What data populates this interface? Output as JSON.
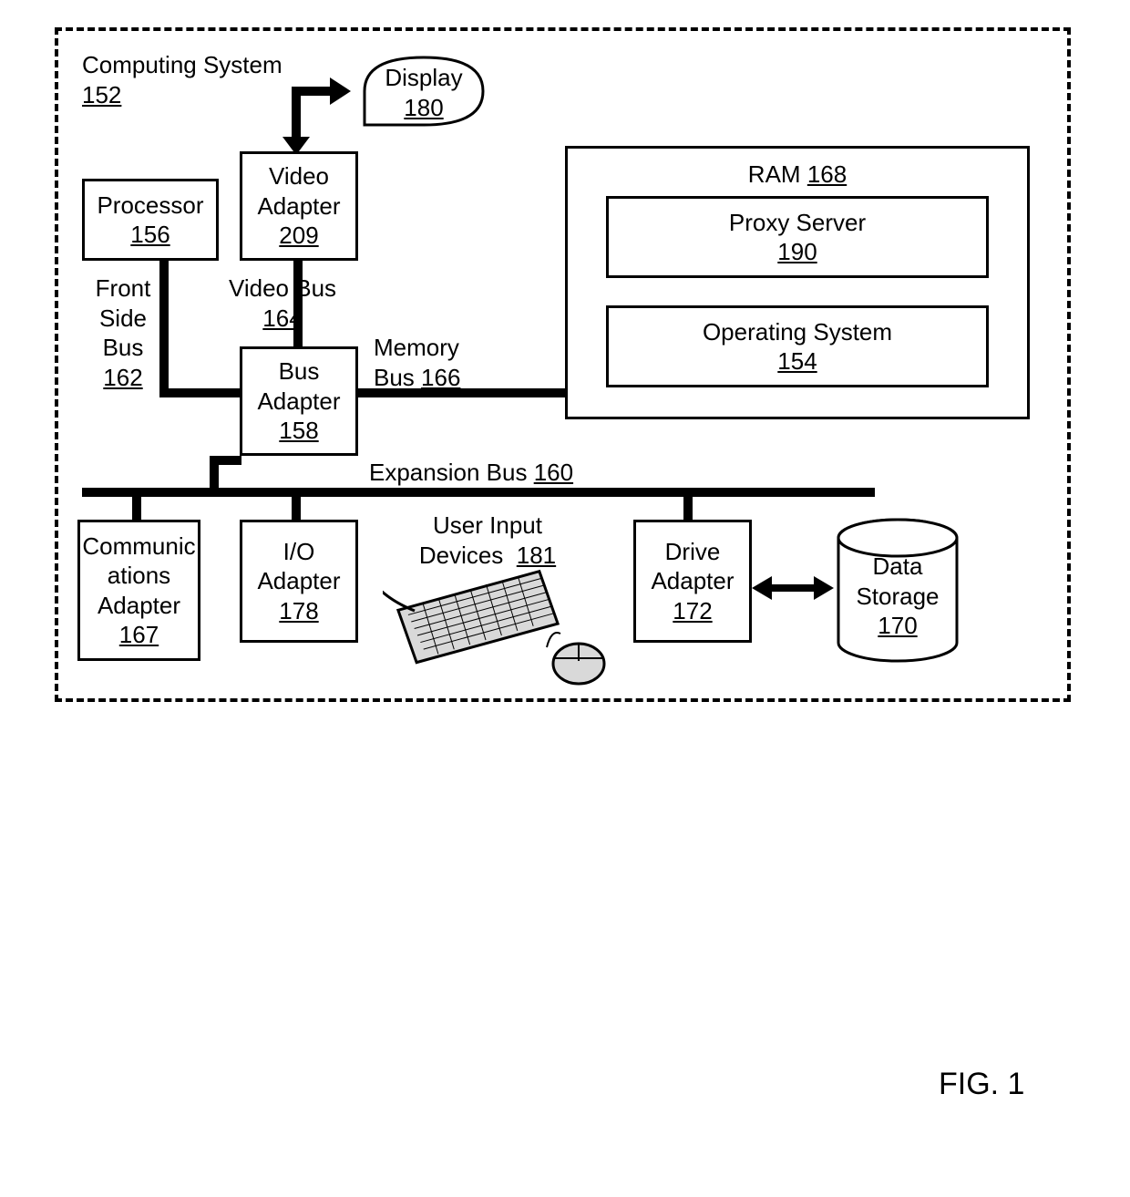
{
  "title": {
    "text": "Computing System",
    "num": "152"
  },
  "figure": "FIG. 1",
  "boxes": {
    "processor": {
      "text": "Processor",
      "num": "156"
    },
    "video_adapter": {
      "text1": "Video",
      "text2": "Adapter",
      "num": "209"
    },
    "bus_adapter": {
      "text1": "Bus",
      "text2": "Adapter",
      "num": "158"
    },
    "comm_adapter": {
      "text1": "Communic",
      "text2": "ations",
      "text3": "Adapter",
      "num": "167"
    },
    "io_adapter": {
      "text1": "I/O",
      "text2": "Adapter",
      "num": "178"
    },
    "drive_adapter": {
      "text1": "Drive",
      "text2": "Adapter",
      "num": "172"
    },
    "ram": {
      "text": "RAM",
      "num": "168"
    },
    "proxy": {
      "text": "Proxy Server",
      "num": "190"
    },
    "os": {
      "text": "Operating System",
      "num": "154"
    },
    "display": {
      "text": "Display",
      "num": "180"
    },
    "storage": {
      "text1": "Data",
      "text2": "Storage",
      "num": "170"
    }
  },
  "labels": {
    "fsb": {
      "l1": "Front",
      "l2": "Side",
      "l3": "Bus",
      "num": "162"
    },
    "video_bus": {
      "text": "Video Bus",
      "num": "164"
    },
    "mem_bus": {
      "text": "Memory",
      "text2": "Bus",
      "num": "166"
    },
    "exp_bus": {
      "text": "Expansion Bus",
      "num": "160"
    },
    "user_input": {
      "text1": "User Input",
      "text2": "Devices",
      "num": "181"
    }
  }
}
